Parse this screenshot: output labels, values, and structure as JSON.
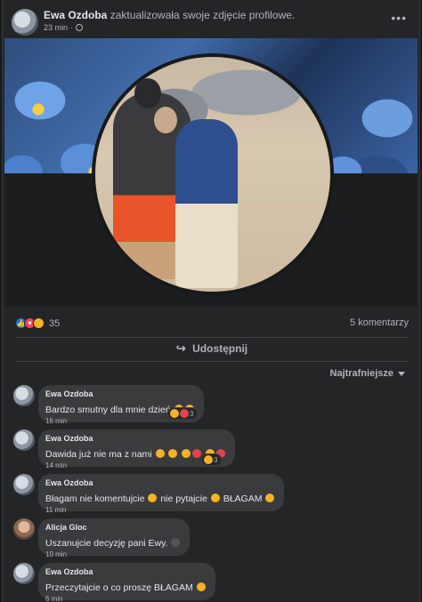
{
  "post": {
    "author": "Ewa Ozdoba",
    "action": "zaktualizowała swoje zdjęcie profilowe.",
    "time": "23 min",
    "more_label": "•••"
  },
  "stats": {
    "reaction_count": "35",
    "comments": "5 komentarzy"
  },
  "actions": {
    "share_label": "Udostępnij"
  },
  "sort": {
    "label": "Najtrafniejsze"
  },
  "comments": [
    {
      "author": "Ewa Ozdoba",
      "text": "Bardzo smutny dla mnie dzień",
      "time": "16 min",
      "reaction_count": "3"
    },
    {
      "author": "Ewa Ozdoba",
      "text": "Dawida już nie ma z nami",
      "time": "14 min",
      "reaction_count": "3"
    },
    {
      "author": "Ewa Ozdoba",
      "text": "Błagam nie komentujcie",
      "text2": "nie pytajcie",
      "text3": "BŁAGAM",
      "time": "11 min"
    },
    {
      "author": "Alicja Gloc",
      "text": "Uszanujcie decyzję pani Ewy.",
      "time": "10 min"
    },
    {
      "author": "Ewa Ozdoba",
      "text": "Przeczytajcie o co proszę BŁAGAM",
      "time": "6 min"
    }
  ],
  "icons": {
    "globe": "globe-icon",
    "share": "share-icon",
    "reactions": [
      "like",
      "love",
      "sad"
    ]
  },
  "colors": {
    "background": "#18191a",
    "card": "#242526",
    "bubble": "#3a3b3c",
    "text": "#e4e6eb",
    "muted": "#b0b3b8",
    "like": "#1877f2",
    "love": "#f33e58",
    "emoji": "#f7b125"
  }
}
